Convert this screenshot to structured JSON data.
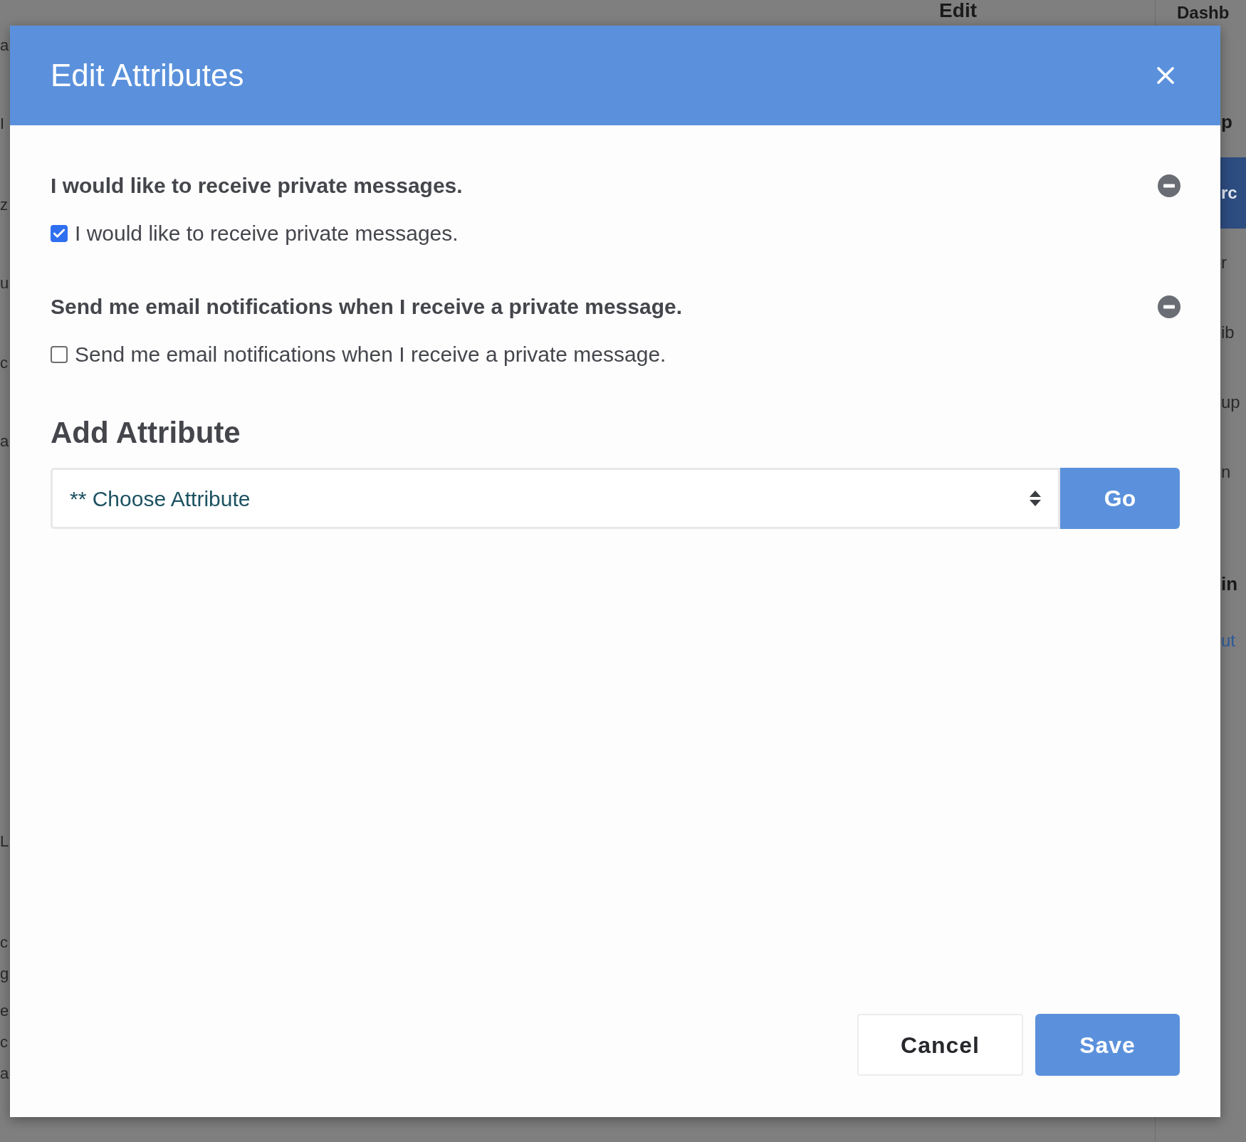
{
  "backdrop": {
    "top_fragments": [
      "Edit",
      "Dashb"
    ],
    "left_fragments": [
      "a",
      "I",
      "z",
      "u",
      "c",
      "a",
      "L",
      "c",
      "g",
      "e",
      "c",
      "a"
    ],
    "right_fragments": [
      {
        "text": "p",
        "kind": "heading"
      },
      {
        "text": "rc",
        "kind": "button"
      },
      {
        "text": "r",
        "kind": "text"
      },
      {
        "text": "ib",
        "kind": "text"
      },
      {
        "text": "up",
        "kind": "text"
      },
      {
        "text": "n",
        "kind": "text"
      },
      {
        "text": "in",
        "kind": "heading"
      },
      {
        "text": "ut",
        "kind": "link"
      }
    ]
  },
  "dialog": {
    "title": "Edit Attributes",
    "attributes": [
      {
        "heading": "I would like to receive private messages.",
        "label": "I would like to receive private messages.",
        "checked": true
      },
      {
        "heading": "Send me email notifications when I receive a private message.",
        "label": "Send me email notifications when I receive a private message.",
        "checked": false
      }
    ],
    "add_section": {
      "heading": "Add Attribute",
      "select": {
        "value": "** Choose Attribute"
      },
      "go_button": "Go"
    },
    "buttons": [
      {
        "label": "Cancel",
        "kind": "secondary"
      },
      {
        "label": "Save",
        "kind": "primary"
      }
    ]
  }
}
